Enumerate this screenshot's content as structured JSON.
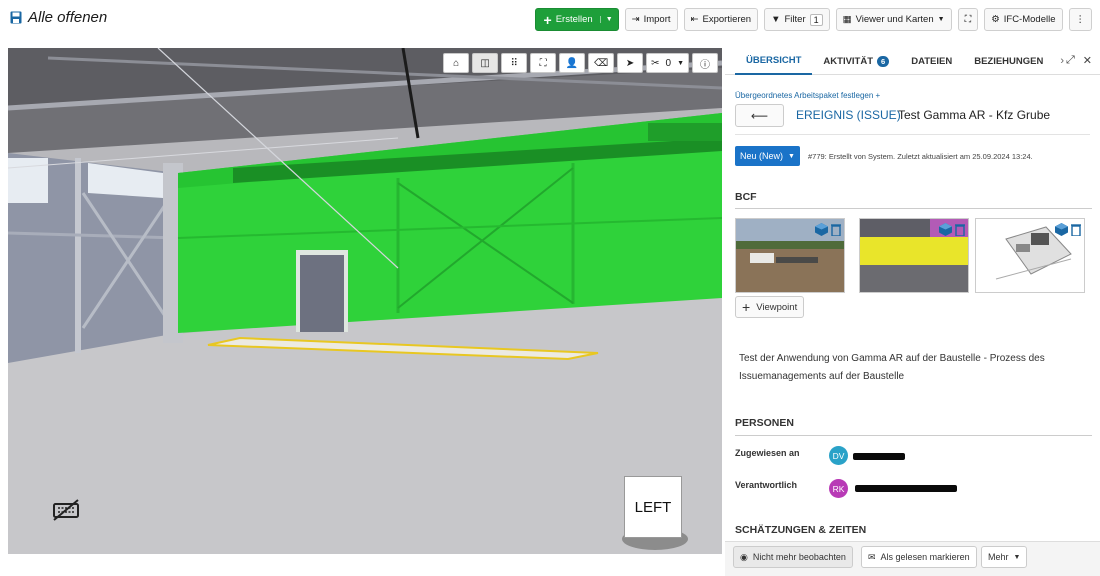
{
  "header": {
    "title": "Alle offenen",
    "buttons": {
      "create": "Erstellen",
      "import": "Import",
      "export": "Exportieren",
      "filter": "Filter",
      "filter_count": "1",
      "viewer": "Viewer und Karten",
      "ifc": "IFC-Modelle"
    }
  },
  "viewer": {
    "clip_count": "0",
    "navcube_face": "LEFT"
  },
  "panel": {
    "tabs": [
      {
        "label": "ÜBERSICHT",
        "active": true
      },
      {
        "label": "AKTIVITÄT",
        "badge": "6"
      },
      {
        "label": "DATEIEN"
      },
      {
        "label": "BEZIEHUNGEN"
      }
    ],
    "parent_link": "Übergeordnetes Arbeitspaket festlegen",
    "type": "EREIGNIS (ISSUE)",
    "subject": "Test Gamma AR - Kfz Grube",
    "status": "Neu (New)",
    "meta": "#779: Erstellt von System. Zuletzt aktualisiert am 25.09.2024 13:24.",
    "bcf_title": "BCF",
    "viewpoint_button": "Viewpoint",
    "description": "Test der Anwendung von Gamma AR auf der Baustelle - Prozess des Issuemanagements auf der Baustelle",
    "persons_title": "PERSONEN",
    "assigned_label": "Zugewiesen an",
    "assigned_initials": "DV",
    "responsible_label": "Verantwortlich",
    "responsible_initials": "RK",
    "estimates_title": "SCHÄTZUNGEN & ZEITEN",
    "footer": {
      "unwatch": "Nicht mehr beobachten",
      "mark_read": "Als gelesen markieren",
      "more": "Mehr"
    }
  },
  "colors": {
    "accent": "#1a67a3",
    "create_green": "#1e9f3a",
    "highlight_green": "#2fd23a",
    "avatar_dv": "#2aa2c8",
    "avatar_rk": "#b83ab6"
  }
}
